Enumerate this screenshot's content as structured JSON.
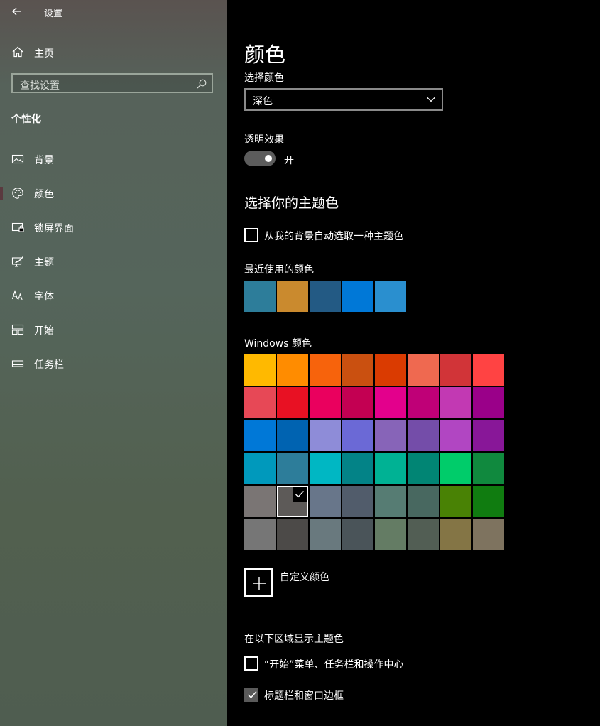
{
  "app": {
    "title": "设置"
  },
  "sidebar": {
    "home_label": "主页",
    "search_placeholder": "查找设置",
    "section_title": "个性化",
    "items": [
      {
        "label": "背景",
        "icon": "picture-icon"
      },
      {
        "label": "颜色",
        "icon": "palette-icon",
        "active": true
      },
      {
        "label": "锁屏界面",
        "icon": "lockscreen-icon"
      },
      {
        "label": "主题",
        "icon": "theme-icon"
      },
      {
        "label": "字体",
        "icon": "font-icon"
      },
      {
        "label": "开始",
        "icon": "start-icon"
      },
      {
        "label": "任务栏",
        "icon": "taskbar-icon"
      }
    ]
  },
  "main": {
    "title": "颜色",
    "choose_color_label": "选择颜色",
    "choose_color_value": "深色",
    "transparency_label": "透明效果",
    "transparency_state": "开",
    "accent_heading": "选择你的主题色",
    "auto_pick_label": "从我的背景自动选取一种主题色",
    "recent_label": "最近使用的颜色",
    "recent_colors": [
      "#2d7d9a",
      "#ca8a2e",
      "#235a84",
      "#0078d7",
      "#2a8fcf"
    ],
    "windows_colors_label": "Windows 颜色",
    "windows_colors": [
      [
        "#ffb900",
        "#ff8c00",
        "#f7630c",
        "#ca5010",
        "#da3b01",
        "#ef6950",
        "#d13438",
        "#ff4343"
      ],
      [
        "#e74856",
        "#e81123",
        "#ea005e",
        "#c30052",
        "#e3008c",
        "#bf0077",
        "#c239b3",
        "#9a0089"
      ],
      [
        "#0078d7",
        "#0063b1",
        "#8e8cd8",
        "#6b69d6",
        "#8764b8",
        "#744da9",
        "#b146c2",
        "#881798"
      ],
      [
        "#0099bc",
        "#2d7d9a",
        "#00b7c3",
        "#038387",
        "#00b294",
        "#018574",
        "#00cc6a",
        "#10893e"
      ],
      [
        "#7a7574",
        "#5d5a58",
        "#68768a",
        "#515c6b",
        "#567c73",
        "#486860",
        "#498205",
        "#107c10"
      ],
      [
        "#767676",
        "#4c4a48",
        "#69797e",
        "#4a5459",
        "#647c64",
        "#525e54",
        "#847545",
        "#7e735f"
      ]
    ],
    "selected_color": "#5d5a58",
    "custom_color_label": "自定义颜色",
    "show_accent_label": "在以下区域显示主题色",
    "show_on_start_label": "“开始”菜单、任务栏和操作中心",
    "show_on_title_label": "标题栏和窗口边框",
    "show_on_start_checked": false,
    "show_on_title_checked": true
  }
}
